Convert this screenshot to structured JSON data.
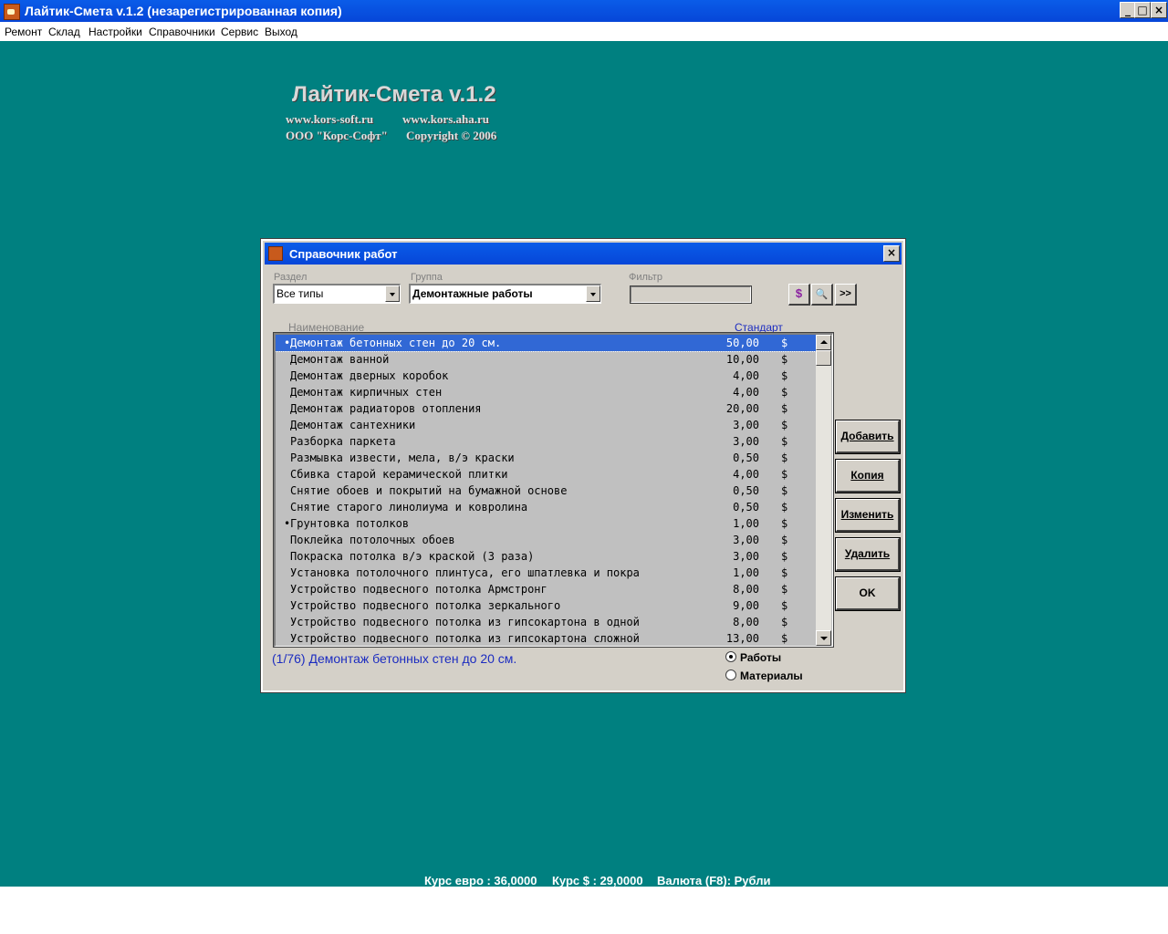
{
  "app": {
    "title": "Лайтик-Смета v.1.2 (незарегистрированная копия)",
    "window_buttons": [
      "_",
      "□",
      "×"
    ]
  },
  "menu": [
    "Ремонт",
    "Склад",
    "Настройки",
    "Справочники",
    "Сервис",
    "Выход"
  ],
  "splash": {
    "title": "Лайтик-Смета v.1.2",
    "site1": "www.kors-soft.ru",
    "site2": "www.kors.aha.ru",
    "company": "ООО \"Корс-Софт\"",
    "copyright": "Copyright © 2006"
  },
  "dialog": {
    "title": "Справочник работ",
    "close": "×",
    "section_label": "Раздел",
    "section_value": "Все типы",
    "group_label": "Группа",
    "group_value": "Демонтажные работы",
    "filter_label": "Фильтр",
    "filter_value": "",
    "tool_buttons": [
      "$",
      "🔍",
      ">>"
    ],
    "col_name": "Наименование",
    "col_standard": "Стандарт",
    "rows": [
      {
        "mark": "•",
        "name": "Демонтаж бетонных стен до 20 см.",
        "price": "50,00",
        "cur": "$"
      },
      {
        "mark": "",
        "name": "Демонтаж ванной",
        "price": "10,00",
        "cur": "$"
      },
      {
        "mark": "",
        "name": "Демонтаж дверных коробок",
        "price": "4,00",
        "cur": "$"
      },
      {
        "mark": "",
        "name": "Демонтаж кирпичных стен",
        "price": "4,00",
        "cur": "$"
      },
      {
        "mark": "",
        "name": "Демонтаж радиаторов отопления",
        "price": "20,00",
        "cur": "$"
      },
      {
        "mark": "",
        "name": "Демонтаж сантехники",
        "price": "3,00",
        "cur": "$"
      },
      {
        "mark": "",
        "name": "Разборка паркета",
        "price": "3,00",
        "cur": "$"
      },
      {
        "mark": "",
        "name": "Размывка извести, мела, в/э краски",
        "price": "0,50",
        "cur": "$"
      },
      {
        "mark": "",
        "name": "Сбивка старой керамической плитки",
        "price": "4,00",
        "cur": "$"
      },
      {
        "mark": "",
        "name": "Снятие обоев и покрытий на бумажной основе",
        "price": "0,50",
        "cur": "$"
      },
      {
        "mark": "",
        "name": "Снятие старого линолиума и ковролина",
        "price": "0,50",
        "cur": "$"
      },
      {
        "mark": "•",
        "name": "Грунтовка потолков",
        "price": "1,00",
        "cur": "$"
      },
      {
        "mark": "",
        "name": "Поклейка потолочных обоев",
        "price": "3,00",
        "cur": "$"
      },
      {
        "mark": "",
        "name": "Покраска потолка в/э краской (3 раза)",
        "price": "3,00",
        "cur": "$"
      },
      {
        "mark": "",
        "name": "Установка потолочного плинтуса, его шпатлевка и покра",
        "price": "1,00",
        "cur": "$"
      },
      {
        "mark": "",
        "name": "Устройство подвесного потолка Армстронг",
        "price": "8,00",
        "cur": "$"
      },
      {
        "mark": "",
        "name": "Устройство подвесного потолка зеркального",
        "price": "9,00",
        "cur": "$"
      },
      {
        "mark": "",
        "name": "Устройство подвесного потолка из гипсокартона в одной",
        "price": "8,00",
        "cur": "$"
      },
      {
        "mark": "",
        "name": "Устройство подвесного потолка из гипсокартона сложной",
        "price": "13,00",
        "cur": "$"
      }
    ],
    "buttons": {
      "add": "Добавить",
      "copy": "Копия",
      "edit": "Изменить",
      "delete": "Удалить",
      "ok": "OK"
    },
    "status": "(1/76)  Демонтаж бетонных стен до 20 см.",
    "radio_works": "Работы",
    "radio_materials": "Материалы",
    "selected_radio": "works"
  },
  "statusbar": {
    "euro": "Курс евро : 36,0000",
    "dollar": "Курс $ : 29,0000",
    "currency": "Валюта (F8): Рубли"
  }
}
